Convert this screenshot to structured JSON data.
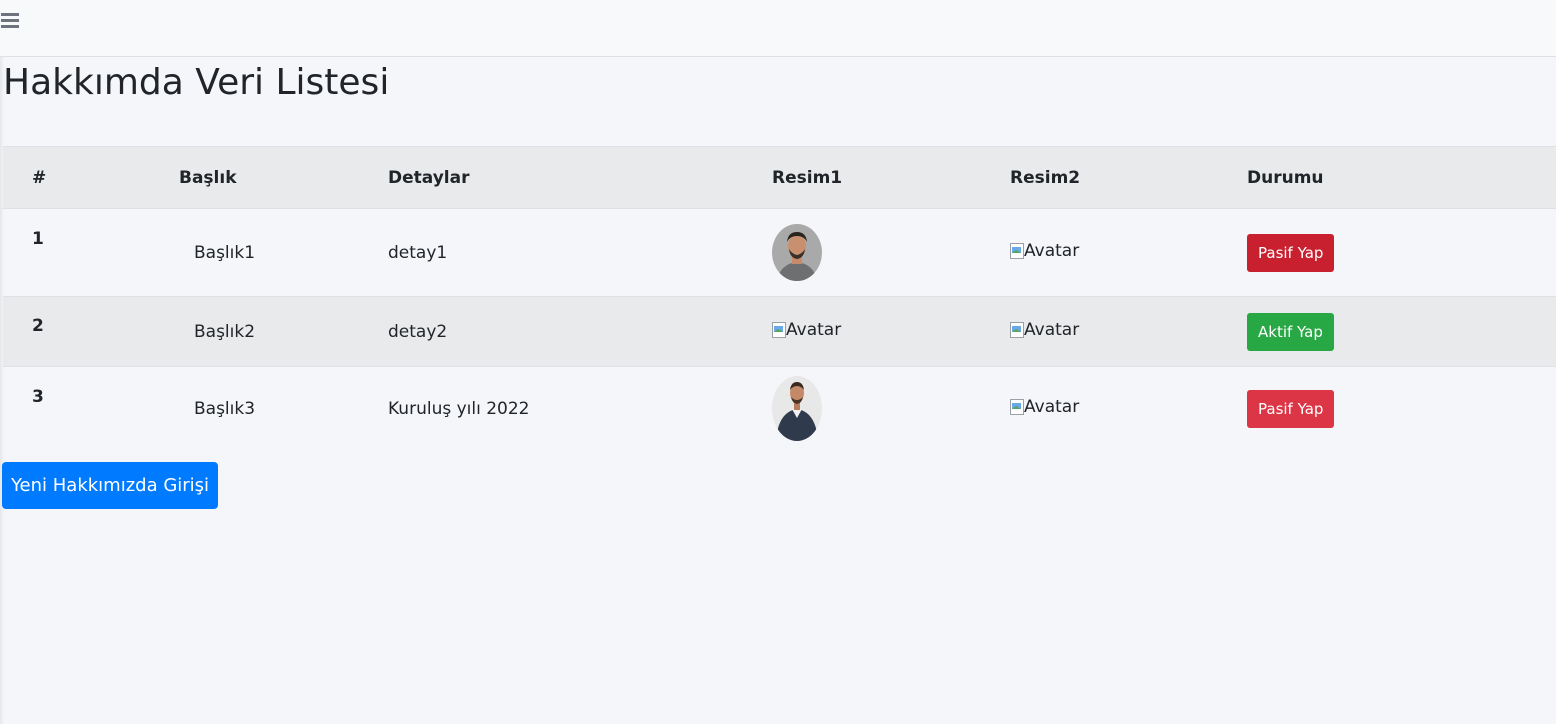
{
  "colors": {
    "accent_blue": "#007bff",
    "danger": "#dc3545",
    "success": "#28a745",
    "background": "#f4f6f9"
  },
  "navbar": {
    "menu_icon": "hamburger-icon"
  },
  "page": {
    "title": "Hakkımda Veri Listesi"
  },
  "table": {
    "headers": [
      "#",
      "Başlık",
      "Detaylar",
      "Resim1",
      "Resim2",
      "Durumu"
    ],
    "rows": [
      {
        "num": "1",
        "title": "Başlık1",
        "details": "detay1",
        "image1": "avatar-photo",
        "image2_alt": "Avatar",
        "status_button": "Pasif Yap"
      },
      {
        "num": "2",
        "title": "Başlık2",
        "details": "detay2",
        "image1_alt": "Avatar",
        "image2_alt": "Avatar",
        "status_button": "Aktif Yap"
      },
      {
        "num": "3",
        "title": "Başlık3",
        "details": "Kuruluş yılı 2022",
        "image1": "avatar-photo",
        "image2_alt": "Avatar",
        "status_button": "Pasif Yap"
      }
    ]
  },
  "actions": {
    "new_entry_button": "Yeni Hakkımızda Girişi"
  }
}
